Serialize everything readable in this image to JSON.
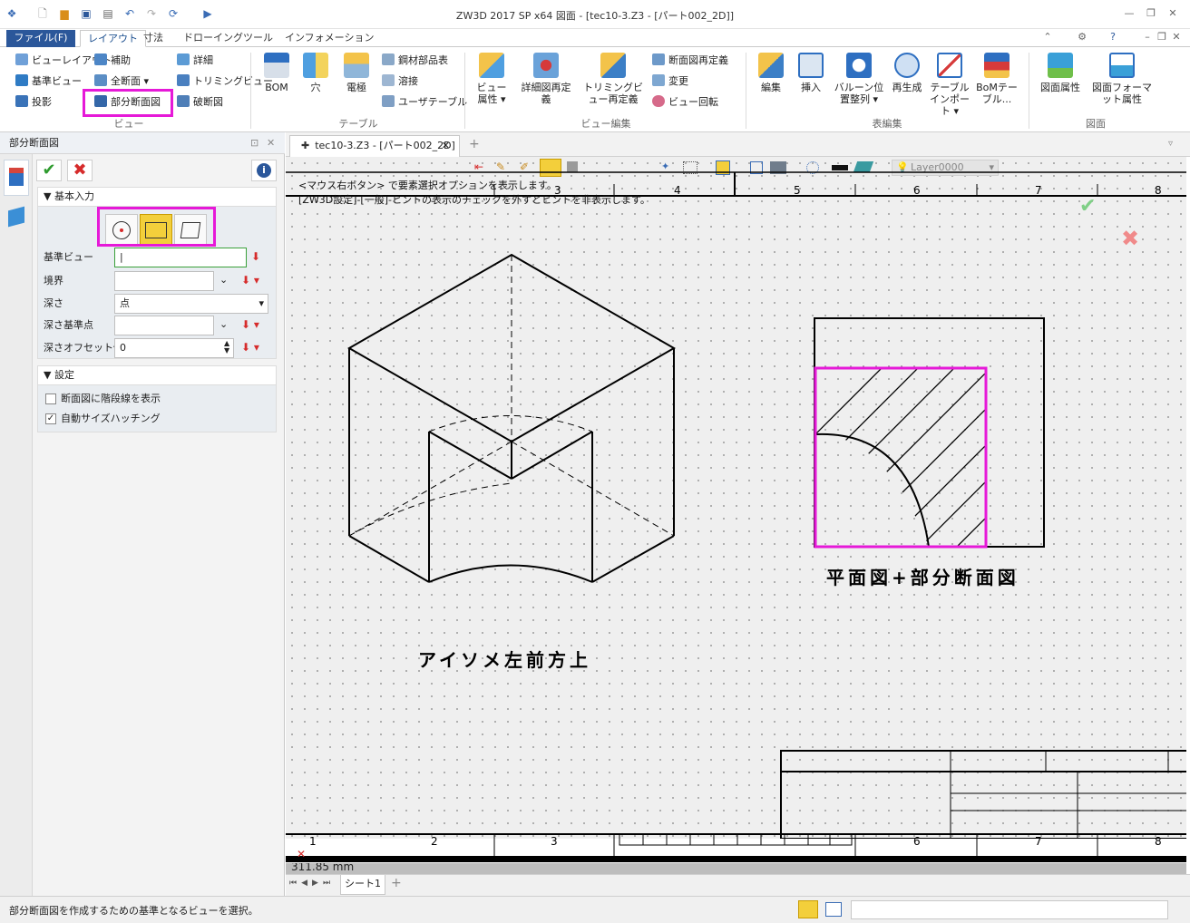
{
  "window": {
    "title": "ZW3D 2017 SP x64      図面 - [tec10-3.Z3 - [パート002_2D]]"
  },
  "menu": {
    "file": "ファイル(F)",
    "tabs": [
      "レイアウト",
      "寸法",
      "ドローイング",
      "ツール",
      "インフォメーション"
    ]
  },
  "ribbon": {
    "view": {
      "items": [
        "ビューレイアウト",
        "補助",
        "詳細",
        "基準ビュー",
        "全断面",
        "トリミングビュー",
        "投影",
        "部分断面図",
        "破断図"
      ],
      "group": "ビュー"
    },
    "table": {
      "bom": "BOM",
      "hole": "穴",
      "electrode": "電極",
      "items": [
        "鋼材部品表",
        "溶接",
        "ユーザテーブル"
      ],
      "group": "テーブル"
    },
    "viewedit": {
      "attr": "ビュー属性",
      "detail": "詳細図再定義",
      "trim": "トリミングビュー再定義",
      "items": [
        "断面図再定義",
        "変更",
        "ビュー回転"
      ],
      "group": "ビュー編集"
    },
    "tableedit": {
      "edit": "編集",
      "insert": "挿入",
      "balloon": "バルーン位置整列",
      "regen": "再生成",
      "import": "テーブルインポート",
      "bomtable": "BoMテーブル...",
      "group": "表編集"
    },
    "sheet": {
      "attr": "図面属性",
      "format": "図面フォーマット属性",
      "group": "図面"
    }
  },
  "panel": {
    "title": "部分断面図",
    "basic_section": "基本入力",
    "fields": [
      {
        "label": "基準ビュー",
        "value": "|"
      },
      {
        "label": "境界",
        "value": ""
      },
      {
        "label": "深さ",
        "value": "点"
      },
      {
        "label": "深さ基準点",
        "value": ""
      },
      {
        "label": "深さオフセット値",
        "value": "0"
      }
    ],
    "settings_section": "設定",
    "options": [
      {
        "label": "断面図に階段線を表示",
        "checked": false
      },
      {
        "label": "自動サイズハッチング",
        "checked": true
      }
    ]
  },
  "document": {
    "tab": "tec10-3.Z3 - [パート002_2D]",
    "layer": "Layer0000"
  },
  "hint": {
    "line1": "<マウス右ボタン> で要素選択オプションを表示します。",
    "line2": "[ZW3D設定]-[一般]-ヒントの表示のチェックを外すとヒントを非表示します。"
  },
  "ruler": {
    "top": [
      "3",
      "4",
      "5",
      "6",
      "7",
      "8"
    ],
    "bottom": [
      "1",
      "2",
      "3",
      "6",
      "7",
      "8"
    ]
  },
  "labels": {
    "iso": "アイソメ左前方上",
    "plan": "平面図+部分断面図"
  },
  "coord": "311.85 mm",
  "sheet_tab": "シート1",
  "status": "部分断面図を作成するための基準となるビューを選択。",
  "colors": {
    "accent": "#2b579a",
    "highlight": "#e619d8",
    "confirm": "#2e9b2e",
    "cancel": "#d62b2b"
  },
  "icons": [
    "save-icon",
    "undo-icon",
    "redo-icon",
    "gear-icon",
    "help-icon",
    "check-icon",
    "close-icon",
    "info-icon",
    "bulb-icon"
  ]
}
